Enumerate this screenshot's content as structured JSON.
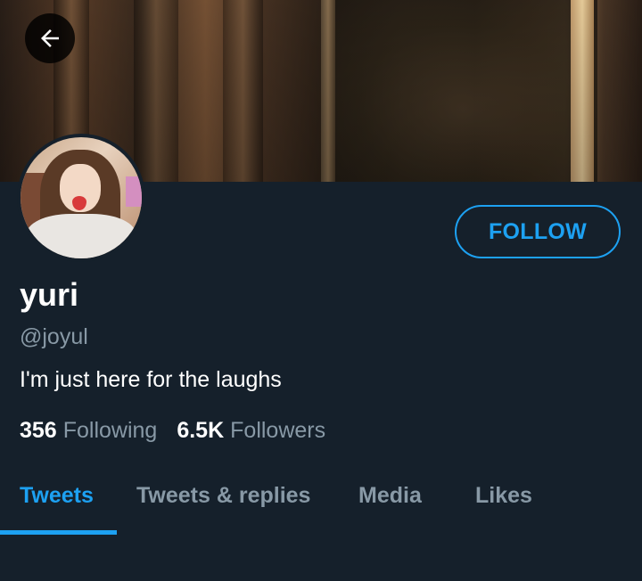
{
  "profile": {
    "name": "yuri",
    "handle": "@joyul",
    "bio": "I'm just here for the laughs",
    "following_count": "356",
    "following_label": "Following",
    "followers_count": "6.5K",
    "followers_label": "Followers"
  },
  "header": {
    "back_icon": "arrow-left-icon"
  },
  "actions": {
    "follow_label": "FOLLOW"
  },
  "tabs": [
    {
      "label": "Tweets",
      "active": true
    },
    {
      "label": "Tweets & replies",
      "active": false
    },
    {
      "label": "Media",
      "active": false
    },
    {
      "label": "Likes",
      "active": false
    }
  ],
  "colors": {
    "background": "#15202b",
    "accent": "#1da1f2",
    "secondary_text": "#8899a6",
    "primary_text": "#ffffff"
  }
}
